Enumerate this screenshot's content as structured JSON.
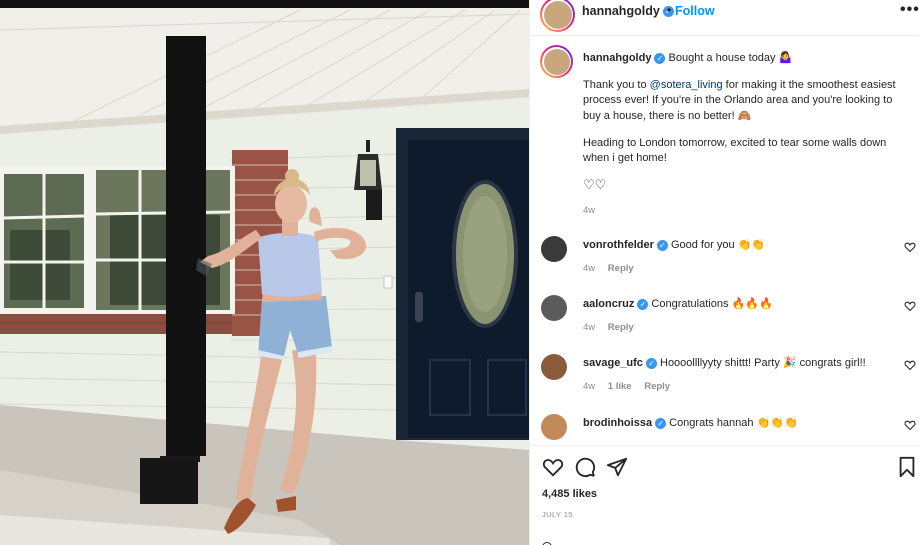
{
  "post": {
    "username": "hannahgoldy",
    "separator": "•",
    "follow_label": "Follow",
    "more_label": "•••",
    "caption": {
      "title": "Bought a house today",
      "title_emoji": "🤷‍♀️",
      "line1_pre": "Thank you to ",
      "line1_mention": "@sotera_living",
      "line1_post": " for making it the smoothest easiest process ever! If you're in the Orlando area and you're looking to buy a house, there is no better!",
      "line1_emoji": "🙈",
      "line2": "Heading to London tomorrow, excited to tear some walls down when i get home!",
      "hearts": "♡♡",
      "time": "4w"
    },
    "likes": "4,485 likes",
    "date": "JULY 15"
  },
  "comments": [
    {
      "username": "vonrothfelder",
      "text": "Good for you",
      "emoji": "👏👏",
      "time": "4w",
      "likes_label": "",
      "reply_label": "Reply"
    },
    {
      "username": "aaloncruz",
      "text": "Congratulations",
      "emoji": "🔥🔥🔥",
      "time": "4w",
      "likes_label": "",
      "reply_label": "Reply"
    },
    {
      "username": "savage_ufc",
      "text": "Hoooollllyyty shittt! Party",
      "emoji": "🎉",
      "text2": " congrats girl!!",
      "time": "4w",
      "likes_label": "1 like",
      "reply_label": "Reply"
    },
    {
      "username": "brodinhoissa",
      "text": "Congrats hannah",
      "emoji": "👏👏👏",
      "time": "",
      "likes_label": "",
      "reply_label": ""
    }
  ],
  "icons": {
    "like": "heart-icon",
    "comment": "comment-icon",
    "share": "share-icon",
    "save": "bookmark-icon",
    "more": "more-icon",
    "verified": "verified-icon"
  },
  "colors": {
    "follow_blue": "#0095f6",
    "verified_blue": "#3897f0",
    "muted": "#8e8e8e",
    "text": "#262626",
    "door": "#0e1b2c"
  }
}
